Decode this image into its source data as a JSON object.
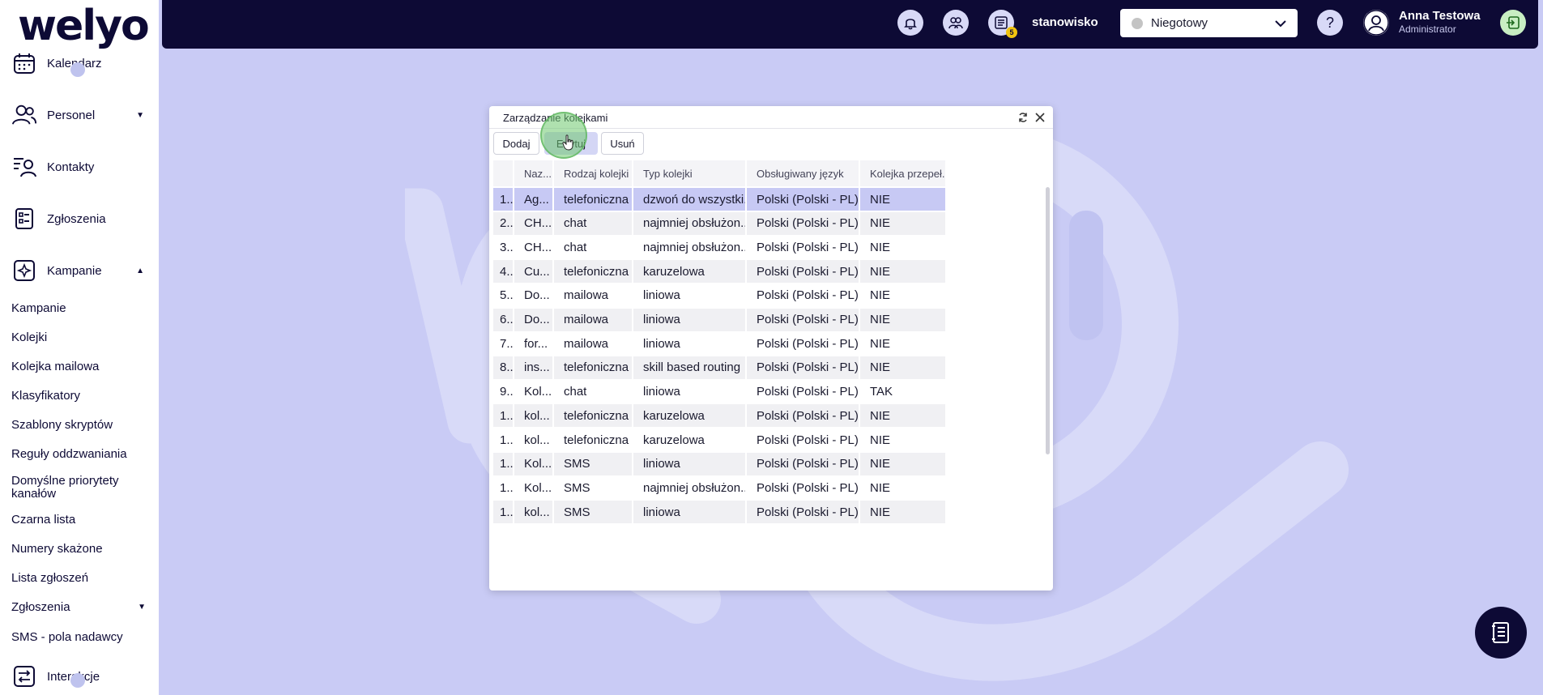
{
  "app": {
    "logo_text": "welyo"
  },
  "sidebar": {
    "main_items": [
      {
        "label": "Kalendarz"
      },
      {
        "label": "Personel"
      },
      {
        "label": "Kontakty"
      },
      {
        "label": "Zgłoszenia"
      },
      {
        "label": "Kampanie"
      },
      {
        "label": "Interakcje"
      }
    ],
    "sub_items": [
      "Kampanie",
      "Kolejki",
      "Kolejka mailowa",
      "Klasyfikatory",
      "Szablony skryptów",
      "Reguły oddzwaniania",
      "Domyślne priorytety kanałów",
      "Czarna lista",
      "Numery skażone",
      "Lista zgłoszeń",
      "Zgłoszenia",
      "SMS - pola nadawcy"
    ]
  },
  "topbar": {
    "tasks_badge": "5",
    "workstation_label": "stanowisko",
    "status_value": "Niegotowy",
    "user_name": "Anna Testowa",
    "user_role": "Administrator"
  },
  "dialog": {
    "title": "Zarządzanie kolejkami",
    "buttons": {
      "add": "Dodaj",
      "edit": "Edytuj",
      "delete": "Usuń"
    },
    "columns": [
      "",
      "Naz...",
      "Rodzaj kolejki",
      "Typ kolejki",
      "Obsługiwany język",
      "Kolejka przepeł..."
    ],
    "rows": [
      [
        "1...",
        "Ag...",
        "telefoniczna",
        "dzwoń do wszystki...",
        "Polski (Polski - PL)",
        "NIE"
      ],
      [
        "2...",
        "CH...",
        "chat",
        "najmniej obsłużon...",
        "Polski (Polski - PL)",
        "NIE"
      ],
      [
        "3...",
        "CH...",
        "chat",
        "najmniej obsłużon...",
        "Polski (Polski - PL)",
        "NIE"
      ],
      [
        "4...",
        "Cu...",
        "telefoniczna",
        "karuzelowa",
        "Polski (Polski - PL)",
        "NIE"
      ],
      [
        "5...",
        "Do...",
        "mailowa",
        "liniowa",
        "Polski (Polski - PL)",
        "NIE"
      ],
      [
        "6...",
        "Do...",
        "mailowa",
        "liniowa",
        "Polski (Polski - PL)",
        "NIE"
      ],
      [
        "7...",
        "for...",
        "mailowa",
        "liniowa",
        "Polski (Polski - PL)",
        "NIE"
      ],
      [
        "8...",
        "ins...",
        "telefoniczna",
        "skill based routing",
        "Polski (Polski - PL)",
        "NIE"
      ],
      [
        "9...",
        "Kol...",
        "chat",
        "liniowa",
        "Polski (Polski - PL)",
        "TAK"
      ],
      [
        "1...",
        "kol...",
        "telefoniczna",
        "karuzelowa",
        "Polski (Polski - PL)",
        "NIE"
      ],
      [
        "1...",
        "kol...",
        "telefoniczna",
        "karuzelowa",
        "Polski (Polski - PL)",
        "NIE"
      ],
      [
        "1...",
        "Kol...",
        "SMS",
        "liniowa",
        "Polski (Polski - PL)",
        "NIE"
      ],
      [
        "1...",
        "Kol...",
        "SMS",
        "najmniej obsłużon...",
        "Polski (Polski - PL)",
        "NIE"
      ],
      [
        "1...",
        "kol...",
        "SMS",
        "liniowa",
        "Polski (Polski - PL)",
        "NIE"
      ]
    ],
    "selected_row": 0
  },
  "colors": {
    "brand_dark": "#0d0a35",
    "background": "#c9cbf5",
    "selection": "#c7c9f4"
  }
}
